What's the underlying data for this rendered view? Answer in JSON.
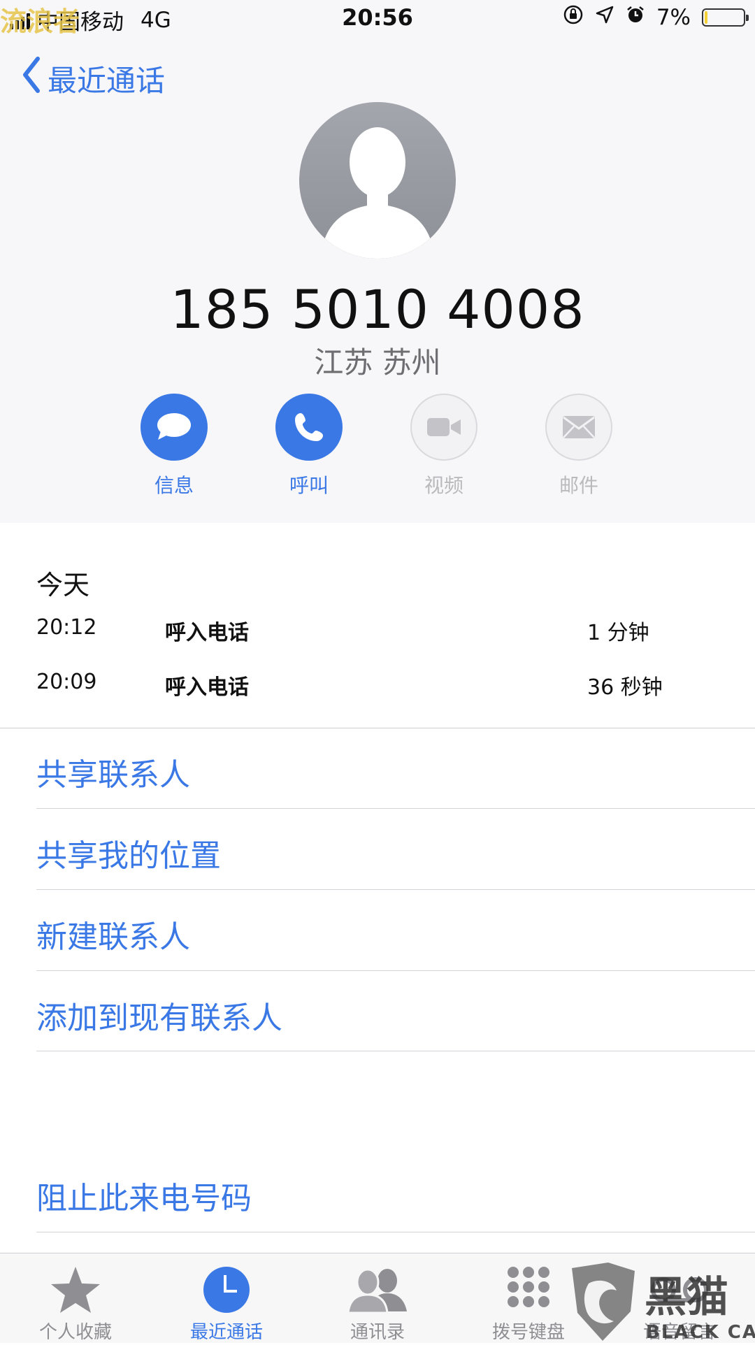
{
  "status_bar": {
    "carrier": "中国移动",
    "network": "4G",
    "time": "20:56",
    "battery": "7%",
    "battery_level": 0.07,
    "battery_color": "#f4d136"
  },
  "nav": {
    "back_label": "最近通话"
  },
  "contact": {
    "phone_number": "185 5010 4008",
    "location": "江苏 苏州"
  },
  "actions": [
    {
      "label": "信息",
      "icon": "message-icon",
      "enabled": true
    },
    {
      "label": "呼叫",
      "icon": "phone-icon",
      "enabled": true
    },
    {
      "label": "视频",
      "icon": "video-icon",
      "enabled": false
    },
    {
      "label": "邮件",
      "icon": "mail-icon",
      "enabled": false
    }
  ],
  "history": {
    "title": "今天",
    "calls": [
      {
        "time": "20:12",
        "type": "呼入电话",
        "duration": "1 分钟"
      },
      {
        "time": "20:09",
        "type": "呼入电话",
        "duration": "36 秒钟"
      }
    ]
  },
  "options": {
    "share_contact": "共享联系人",
    "share_location": "共享我的位置",
    "new_contact": "新建联系人",
    "add_to_existing": "添加到现有联系人",
    "block_caller": "阻止此来电号码"
  },
  "tabs": [
    {
      "label": "个人收藏",
      "icon": "star-icon",
      "active": false
    },
    {
      "label": "最近通话",
      "icon": "clock-icon",
      "active": true
    },
    {
      "label": "通讯录",
      "icon": "contacts-icon",
      "active": false
    },
    {
      "label": "拨号键盘",
      "icon": "keypad-icon",
      "active": false
    },
    {
      "label": "语音留言",
      "icon": "voicemail-icon",
      "active": false
    }
  ],
  "watermarks": {
    "top_left": "流浪者",
    "bottom_right": "黑猫 BLACK CAT"
  },
  "colors": {
    "accent": "#3a78e6",
    "disabled": "#b9b9be",
    "header_bg": "#f7f7f9"
  }
}
